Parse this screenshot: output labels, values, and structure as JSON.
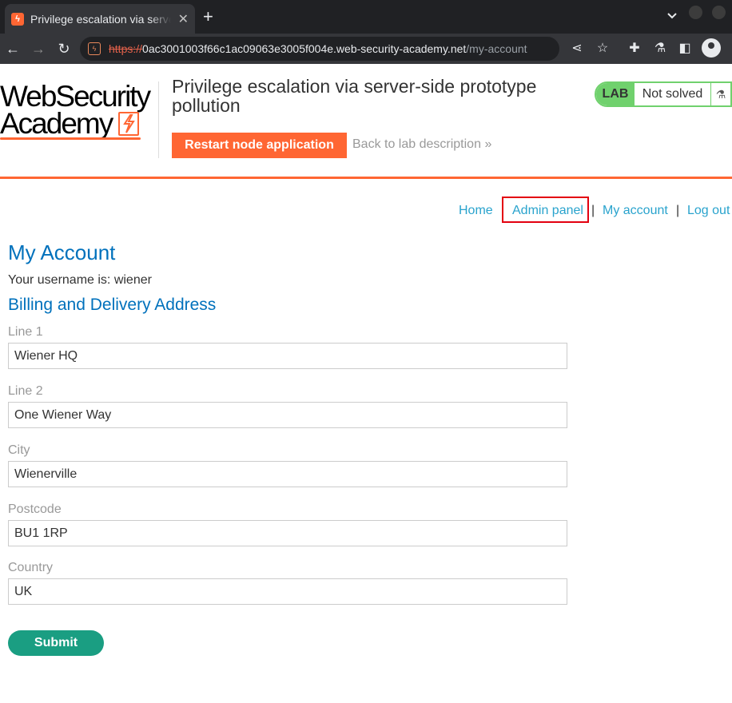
{
  "browser": {
    "tab_title": "Privilege escalation via server-side prototype pollution",
    "tab_favicon": "portswigger-bolt-icon",
    "url_scheme": "https://",
    "url_host": "0ac3001003f66c1ac09063e3005f004e.web-security-academy.net",
    "url_path": "/my-account"
  },
  "lab": {
    "logo_line1": "WebSecurity",
    "logo_line2": "Academy",
    "title": "Privilege escalation via server-side prototype pollution",
    "restart_label": "Restart node application",
    "back_label": "Back to lab description",
    "status_badge": "LAB",
    "status_text": "Not solved",
    "accent_color": "#ff6633",
    "status_color": "#70d16d"
  },
  "nav": {
    "home": "Home",
    "admin_panel": "Admin panel",
    "my_account": "My account",
    "log_out": "Log out",
    "separator": "|"
  },
  "account": {
    "heading": "My Account",
    "username_line": "Your username is: wiener",
    "address_heading": "Billing and Delivery Address",
    "fields": [
      {
        "label": "Line 1",
        "value": "Wiener HQ"
      },
      {
        "label": "Line 2",
        "value": "One Wiener Way"
      },
      {
        "label": "City",
        "value": "Wienerville"
      },
      {
        "label": "Postcode",
        "value": "BU1 1RP"
      },
      {
        "label": "Country",
        "value": "UK"
      }
    ],
    "submit_label": "Submit"
  }
}
